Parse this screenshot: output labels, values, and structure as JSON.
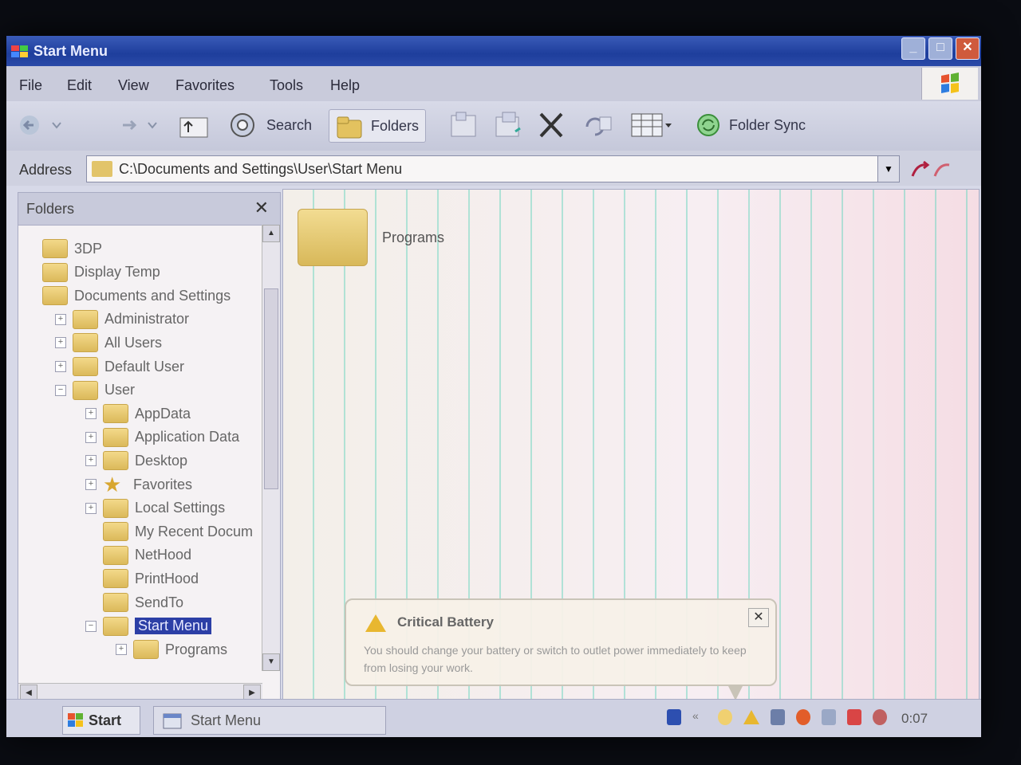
{
  "window": {
    "title": "Start Menu",
    "controls": {
      "minimize": "_",
      "maximize": "□",
      "close": "✕"
    }
  },
  "menu": [
    "File",
    "Edit",
    "View",
    "Favorites",
    "Tools",
    "Help"
  ],
  "toolbar": {
    "search_label": "Search",
    "folders_label": "Folders",
    "folder_sync_label": "Folder Sync"
  },
  "address": {
    "label": "Address",
    "value": "C:\\Documents and Settings\\User\\Start Menu"
  },
  "folders_pane": {
    "title": "Folders",
    "close": "✕",
    "tree": [
      {
        "label": "3DP",
        "depth": 0,
        "expander": "",
        "icon": "folder-icon"
      },
      {
        "label": "Display Temp",
        "depth": 0,
        "expander": "",
        "icon": "folder-icon"
      },
      {
        "label": "Documents and Settings",
        "depth": 0,
        "expander": "",
        "icon": "folder-icon"
      },
      {
        "label": "Administrator",
        "depth": 1,
        "expander": "+",
        "icon": "folder-icon"
      },
      {
        "label": "All Users",
        "depth": 1,
        "expander": "+",
        "icon": "folder-icon"
      },
      {
        "label": "Default User",
        "depth": 1,
        "expander": "+",
        "icon": "folder-icon"
      },
      {
        "label": "User",
        "depth": 1,
        "expander": "−",
        "icon": "folder-icon"
      },
      {
        "label": "AppData",
        "depth": 2,
        "expander": "+",
        "icon": "folder-icon"
      },
      {
        "label": "Application Data",
        "depth": 2,
        "expander": "+",
        "icon": "folder-icon"
      },
      {
        "label": "Desktop",
        "depth": 2,
        "expander": "+",
        "icon": "folder-icon"
      },
      {
        "label": "Favorites",
        "depth": 2,
        "expander": "+",
        "icon": "star-icon"
      },
      {
        "label": "Local Settings",
        "depth": 2,
        "expander": "+",
        "icon": "folder-icon"
      },
      {
        "label": "My Recent Docum",
        "depth": 2,
        "expander": "",
        "icon": "folder-icon"
      },
      {
        "label": "NetHood",
        "depth": 2,
        "expander": "",
        "icon": "folder-icon"
      },
      {
        "label": "PrintHood",
        "depth": 2,
        "expander": "",
        "icon": "folder-icon"
      },
      {
        "label": "SendTo",
        "depth": 2,
        "expander": "",
        "icon": "folder-icon"
      },
      {
        "label": "Start Menu",
        "depth": 2,
        "expander": "−",
        "icon": "folder-icon",
        "selected": true
      },
      {
        "label": "Programs",
        "depth": 3,
        "expander": "+",
        "icon": "programs-folder-icon"
      }
    ]
  },
  "content": {
    "items": [
      {
        "label": "Programs",
        "icon": "folder-icon"
      }
    ]
  },
  "balloon": {
    "title": "Critical Battery",
    "text": "You should change your battery or switch to outlet power immediately to keep from losing your work.",
    "close": "✕"
  },
  "taskbar": {
    "start_label": "Start",
    "task_label": "Start Menu",
    "clock": "0:07"
  },
  "colors": {
    "titlebar": "#1e3e9c",
    "selection": "#2c3fa6",
    "warning": "#e8b730"
  }
}
